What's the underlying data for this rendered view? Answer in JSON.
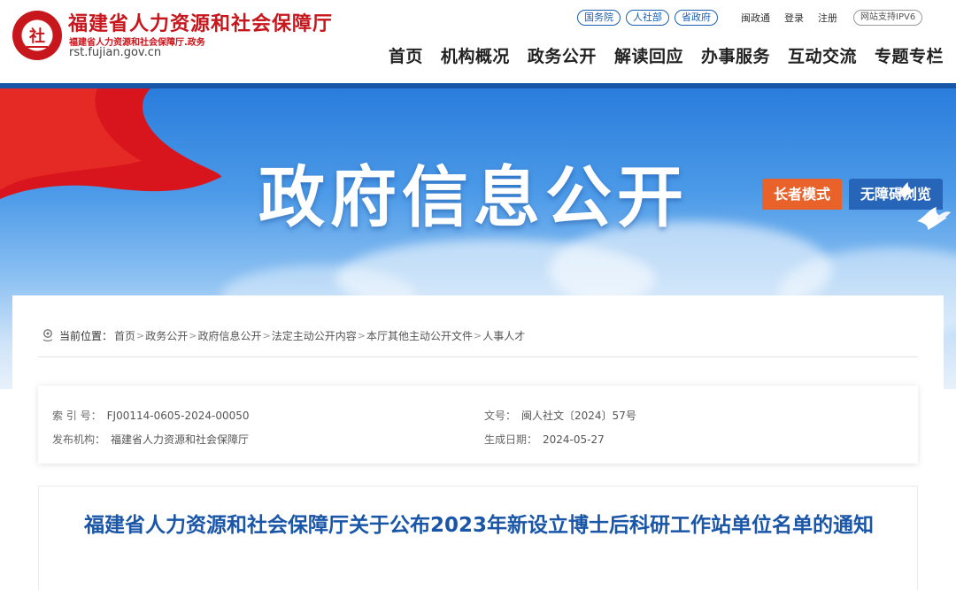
{
  "header": {
    "site_title": "福建省人力资源和社会保障厅",
    "site_subtitle": "福建省人力资源和社会保障厅.政务",
    "site_domain": "rst.fujian.gov.cn",
    "top_links": {
      "pills": [
        "国务院",
        "人社部",
        "省政府"
      ],
      "plain": [
        "闽政通",
        "登录",
        "注册"
      ],
      "ipv6": "网站支持IPV6"
    },
    "nav": [
      "首页",
      "机构概况",
      "政务公开",
      "解读回应",
      "办事服务",
      "互动交流",
      "专题专栏"
    ]
  },
  "banner": {
    "title": "政府信息公开",
    "elder_mode": "长者模式",
    "accessible": "无障碍浏览"
  },
  "breadcrumb": {
    "label": "当前位置：",
    "items": [
      "首页",
      "政务公开",
      "政府信息公开",
      "法定主动公开内容",
      "本厅其他主动公开文件",
      "人事人才"
    ],
    "separator": ">"
  },
  "meta": {
    "index_key": "索 引 号：",
    "index_val": "FJ00114-0605-2024-00050",
    "docno_key": "文号：",
    "docno_val": "闽人社文〔2024〕57号",
    "publisher_key": "发布机构：",
    "publisher_val": "福建省人力资源和社会保障厅",
    "date_key": "生成日期：",
    "date_val": "2024-05-27"
  },
  "article": {
    "title": "福建省人力资源和社会保障厅关于公布2023年新设立博士后科研工作站单位名单的通知"
  },
  "colors": {
    "brand_red": "#c8161d",
    "brand_blue": "#1a56a8",
    "elder_orange": "#e8622a",
    "access_blue": "#2765b9"
  }
}
